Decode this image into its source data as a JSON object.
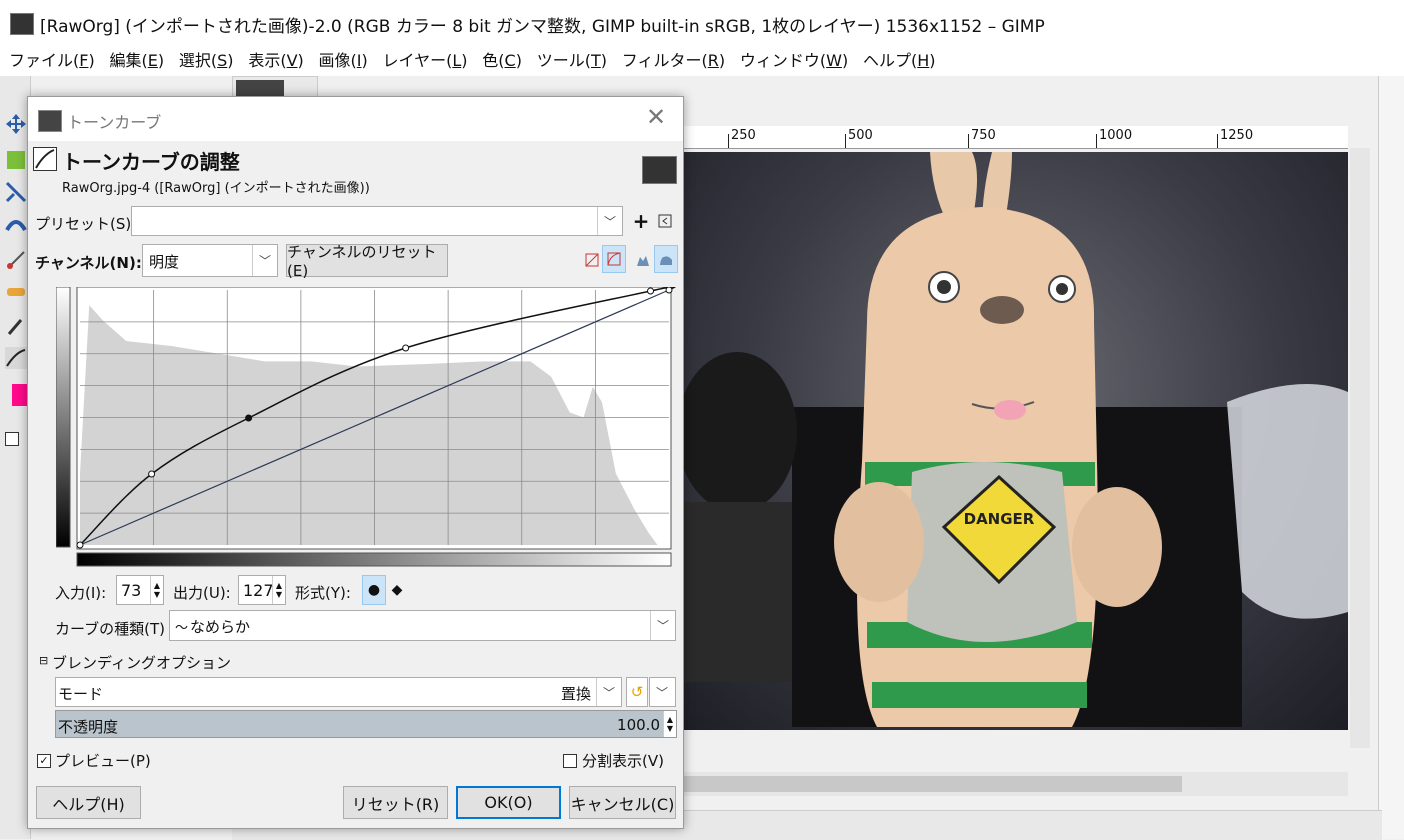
{
  "window": {
    "title": "[RawOrg] (インポートされた画像)-2.0 (RGB カラー 8 bit ガンマ整数, GIMP built-in sRGB, 1枚のレイヤー) 1536x1152 – GIMP"
  },
  "menubar": [
    "ファイル(F)",
    "編集(E)",
    "選択(S)",
    "表示(V)",
    "画像(I)",
    "レイヤー(L)",
    "色(C)",
    "ツール(T)",
    "フィルター(R)",
    "ウィンドウ(W)",
    "ヘルプ(H)"
  ],
  "ruler": {
    "labels": [
      "250",
      "500",
      "750",
      "1000",
      "1250"
    ]
  },
  "dialog": {
    "title": "トーンカーブ",
    "heading": "トーンカーブの調整",
    "subtitle": "RawOrg.jpg-4 ([RawOrg] (インポートされた画像))",
    "preset_label": "プリセット(S):",
    "preset_value": "",
    "channel_label": "チャンネル(N):",
    "channel_value": "明度",
    "reset_channel_label": "チャンネルのリセット(E)",
    "input_label": "入力(I):",
    "input_value": "73",
    "output_label": "出力(U):",
    "output_value": "127",
    "type_label": "形式(Y):",
    "curve_type_label": "カーブの種類(T)",
    "curve_type_value": "なめらか",
    "blending_label": "ブレンディングオプション",
    "mode_label": "モード",
    "mode_value": "置換",
    "opacity_label": "不透明度",
    "opacity_value": "100.0",
    "preview_label": "プレビュー(P)",
    "preview_checked": true,
    "split_label": "分割表示(V)",
    "split_checked": false,
    "buttons": {
      "help": "ヘルプ(H)",
      "reset": "リセット(R)",
      "ok": "OK(O)",
      "cancel": "キャンセル(C)"
    }
  },
  "curve": {
    "control_points": [
      {
        "input": 0,
        "output": 0
      },
      {
        "input": 31,
        "output": 71
      },
      {
        "input": 73,
        "output": 127
      },
      {
        "input": 141,
        "output": 197
      },
      {
        "input": 247,
        "output": 254
      },
      {
        "input": 255,
        "output": 255
      }
    ],
    "selected_input": 73
  },
  "image": {
    "sign_text": "DANGER"
  },
  "colors": {
    "accent": "#0078d7",
    "foreground": "#ff0a8c"
  }
}
